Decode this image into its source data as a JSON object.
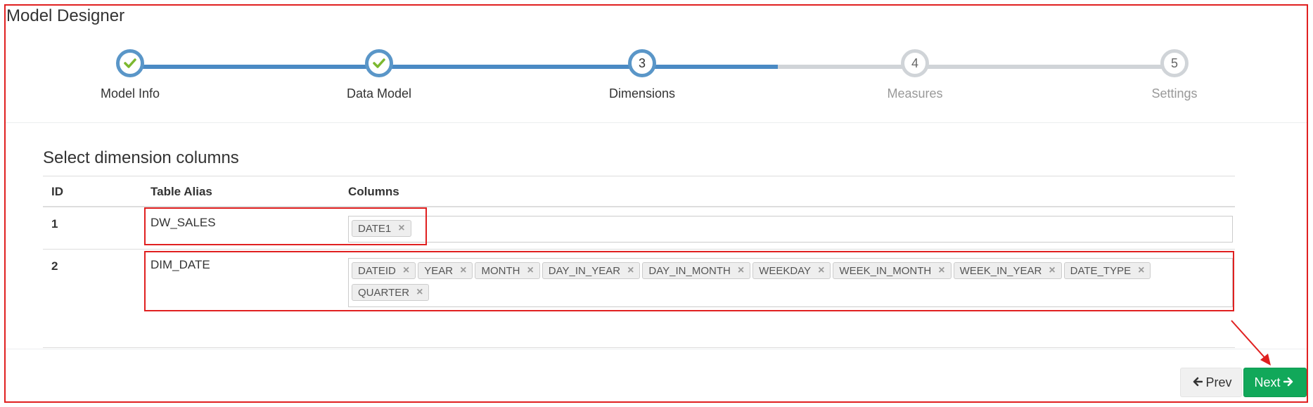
{
  "app": {
    "title": "Model Designer"
  },
  "wizard": {
    "steps": [
      {
        "number": "1",
        "label": "Model Info",
        "status": "done"
      },
      {
        "number": "2",
        "label": "Data Model",
        "status": "done"
      },
      {
        "number": "3",
        "label": "Dimensions",
        "status": "active"
      },
      {
        "number": "4",
        "label": "Measures",
        "status": "todo"
      },
      {
        "number": "5",
        "label": "Settings",
        "status": "todo"
      }
    ]
  },
  "section": {
    "title": "Select dimension columns"
  },
  "table": {
    "headers": {
      "id": "ID",
      "alias": "Table Alias",
      "columns": "Columns"
    },
    "rows": [
      {
        "id": "1",
        "alias": "DW_SALES",
        "columns": [
          "DATE1"
        ]
      },
      {
        "id": "2",
        "alias": "DIM_DATE",
        "columns": [
          "DATEID",
          "YEAR",
          "MONTH",
          "DAY_IN_YEAR",
          "DAY_IN_MONTH",
          "WEEKDAY",
          "WEEK_IN_MONTH",
          "WEEK_IN_YEAR",
          "DATE_TYPE",
          "QUARTER"
        ]
      }
    ]
  },
  "buttons": {
    "prev": "Prev",
    "next": "Next"
  },
  "icons": {
    "remove": "×",
    "done": "✔",
    "arrow_left": "🡐",
    "arrow_right": "🡒"
  },
  "colors": {
    "accent": "#5a96c8",
    "success": "#11a85a",
    "annotation": "#e02020"
  }
}
